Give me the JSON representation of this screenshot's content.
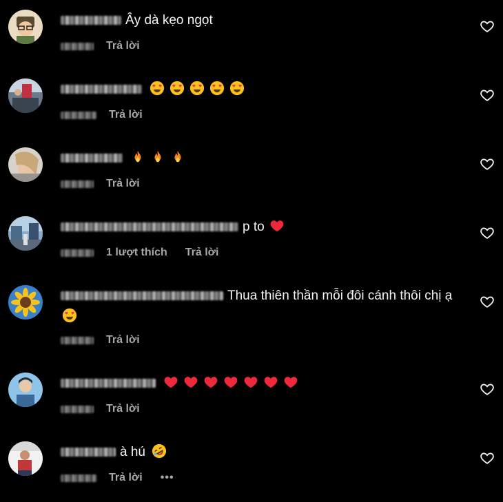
{
  "reply_label": "Trả lời",
  "comments": [
    {
      "text": "Ây dà kẹo ngọt",
      "emoji": []
    },
    {
      "text": "",
      "emoji": [
        "heart-eyes",
        "heart-eyes",
        "heart-eyes",
        "heart-eyes",
        "heart-eyes"
      ]
    },
    {
      "text": "",
      "emoji": [
        "fire",
        "fire",
        "fire"
      ]
    },
    {
      "text": "p to",
      "emoji": [
        "red-heart"
      ],
      "likes": "1 lượt thích"
    },
    {
      "text": "Thua thiên thần mỗi đôi cánh thôi chị ạ",
      "emoji": [
        "heart-eyes"
      ]
    },
    {
      "text": "",
      "emoji": [
        "red-heart",
        "red-heart",
        "red-heart",
        "red-heart",
        "red-heart",
        "red-heart",
        "red-heart"
      ]
    },
    {
      "text": "à hú",
      "emoji": [
        "rofl"
      ],
      "more": "•••"
    }
  ],
  "colors": {
    "background": "#000000",
    "text": "#f5f5f5",
    "meta": "#a8a8a8"
  }
}
